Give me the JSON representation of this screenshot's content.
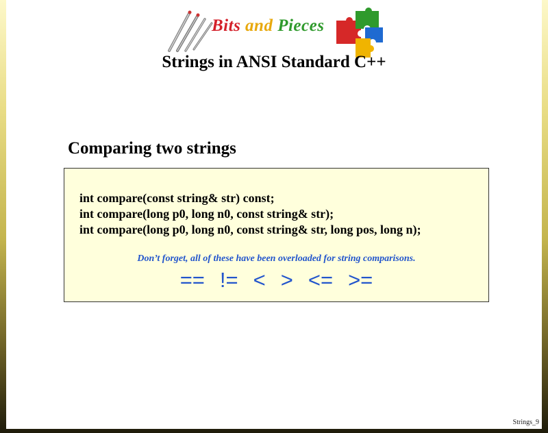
{
  "logo": {
    "word1": "Bits",
    "word2": "and",
    "word3": "Pieces",
    "drill_icon": "drill-bits-icon",
    "puzzle_icon": "puzzle-pieces-icon"
  },
  "title": "Strings in ANSI Standard C++",
  "subtitle": "Comparing two strings",
  "code": [
    "int compare(const string& str) const;",
    "int compare(long p0, long n0, const string& str);",
    "int compare(long p0, long n0, const string& str, long pos, long n);"
  ],
  "note": "Don’t forget, all of these have been overloaded for string comparisons.",
  "operators": [
    "==",
    "!=",
    "<",
    ">",
    "<=",
    ">="
  ],
  "slide_number": "Strings_9",
  "colors": {
    "accent_blue": "#2255cc",
    "box_fill": "#ffffdc",
    "logo_red": "#d4202a",
    "logo_yellow": "#e8a80c",
    "logo_green": "#2f9a2c"
  }
}
